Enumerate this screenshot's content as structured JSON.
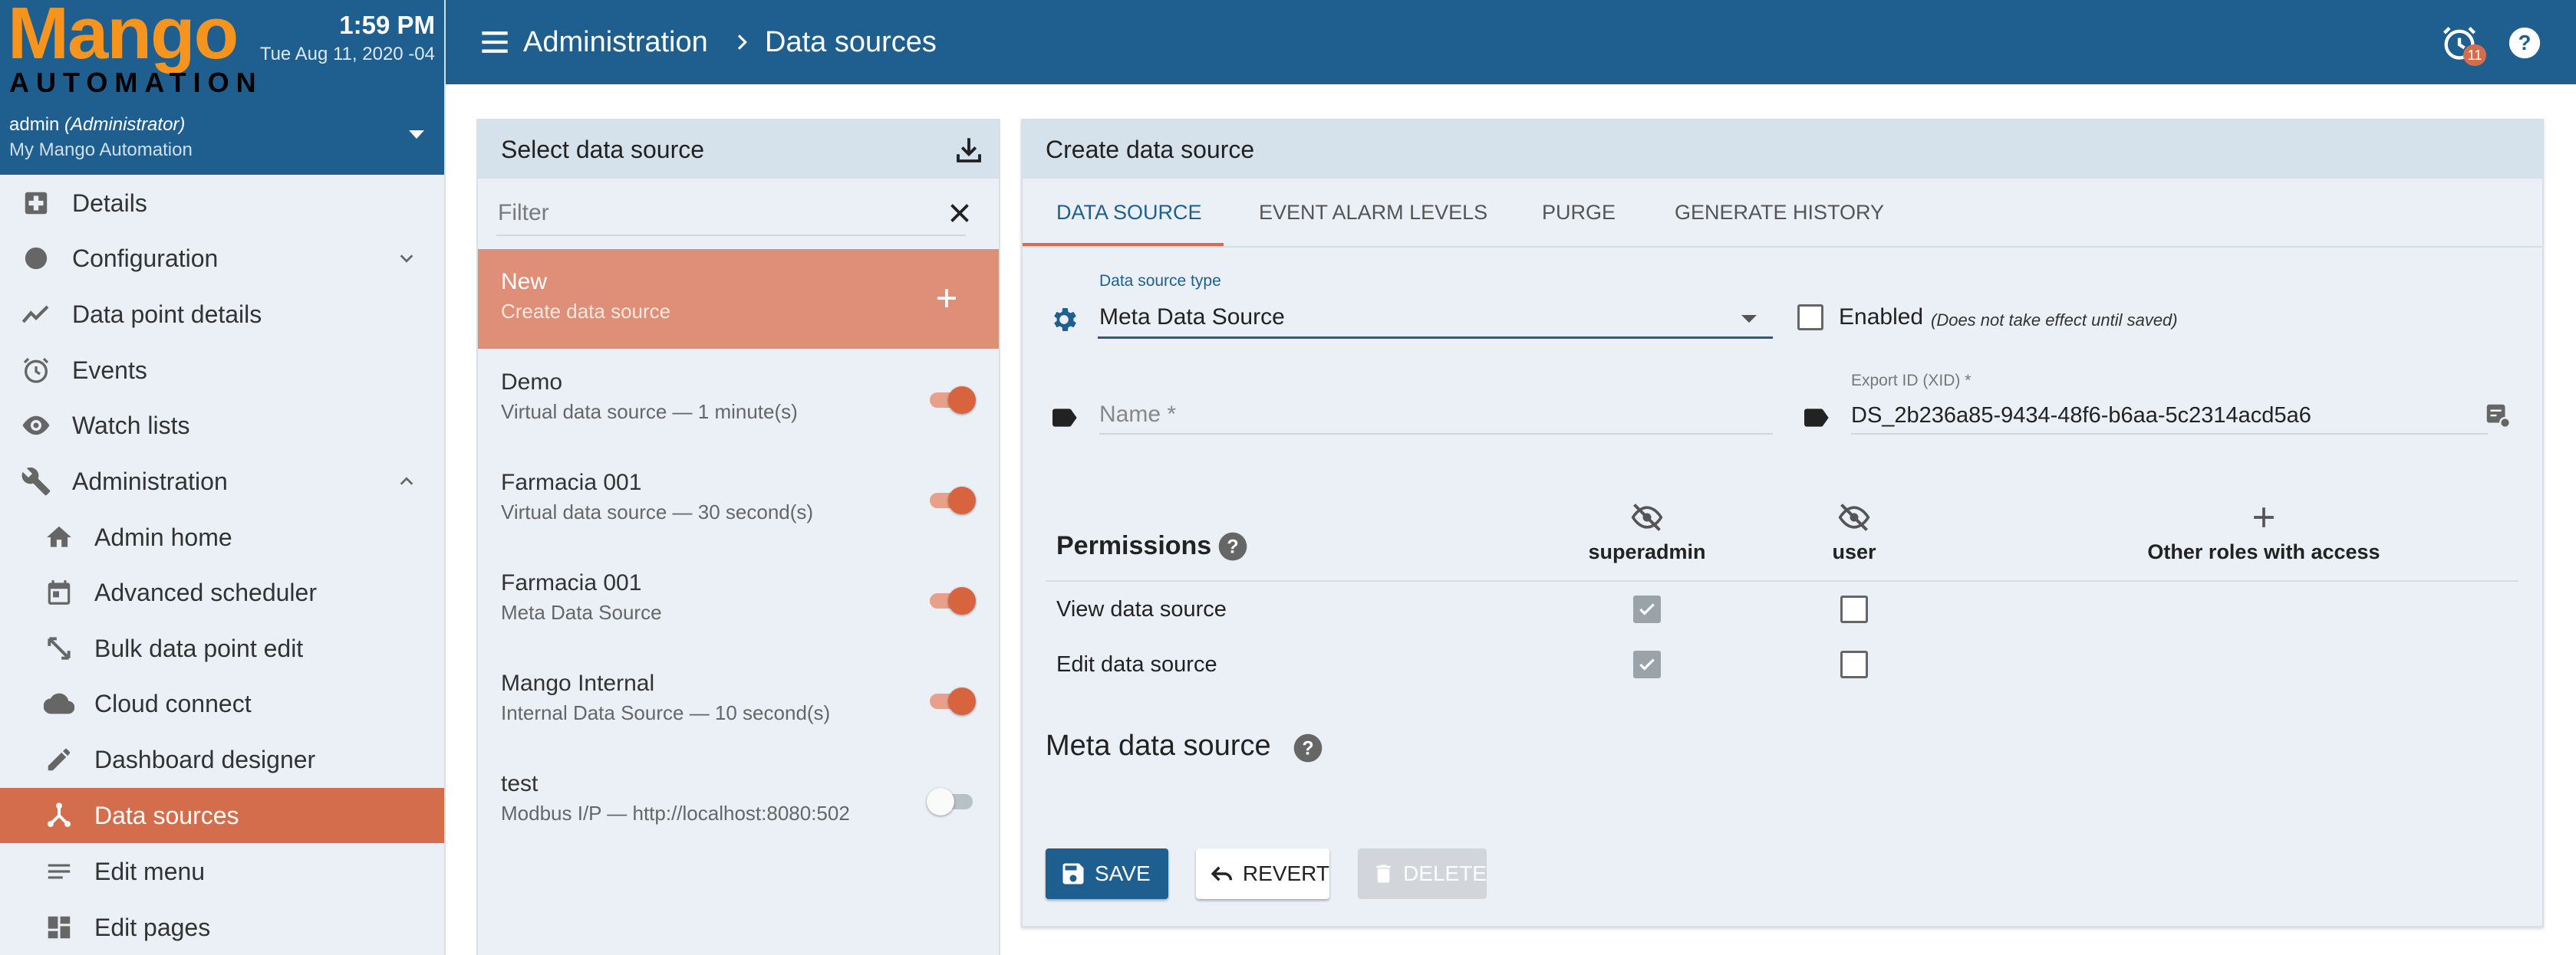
{
  "brand": {
    "logo_top": "Mango",
    "logo_bottom": "AUTOMATION",
    "time": "1:59 PM",
    "date": "Tue Aug 11, 2020 -04",
    "user_name": "admin",
    "user_role": "(Administrator)",
    "site_name": "My Mango Automation"
  },
  "sidebar": {
    "items": [
      {
        "label": "Details",
        "icon": "hospital-add-icon"
      },
      {
        "label": "Configuration",
        "icon": "circle-icon"
      },
      {
        "label": "Data point details",
        "icon": "trending-line-icon"
      },
      {
        "label": "Events",
        "icon": "alarm-clock-icon"
      },
      {
        "label": "Watch lists",
        "icon": "eye-icon"
      },
      {
        "label": "Administration",
        "icon": "wrench-icon"
      },
      {
        "label": "Admin home",
        "icon": "home-icon"
      },
      {
        "label": "Advanced scheduler",
        "icon": "calendar-icon"
      },
      {
        "label": "Bulk data point edit",
        "icon": "expand-arrows-icon"
      },
      {
        "label": "Cloud connect",
        "icon": "cloud-icon"
      },
      {
        "label": "Dashboard designer",
        "icon": "pencil-icon"
      },
      {
        "label": "Data sources",
        "icon": "share-nodes-icon"
      },
      {
        "label": "Edit menu",
        "icon": "list-icon"
      },
      {
        "label": "Edit pages",
        "icon": "dashboard-icon"
      }
    ],
    "active": "Data sources"
  },
  "topbar": {
    "breadcrumb_parent": "Administration",
    "breadcrumb_current": "Data sources",
    "alarm_count": "11"
  },
  "select_panel": {
    "title": "Select data source",
    "filter_placeholder": "Filter",
    "new_item": {
      "name": "New",
      "desc": "Create data source"
    },
    "items": [
      {
        "name": "Demo",
        "desc": "Virtual data source — 1 minute(s)",
        "enabled": true
      },
      {
        "name": "Farmacia 001",
        "desc": "Virtual data source — 30 second(s)",
        "enabled": true
      },
      {
        "name": "Farmacia 001",
        "desc": "Meta Data Source",
        "enabled": true
      },
      {
        "name": "Mango Internal",
        "desc": "Internal Data Source — 10 second(s)",
        "enabled": true
      },
      {
        "name": "test",
        "desc": "Modbus I/P — http://localhost:8080:502",
        "enabled": false
      }
    ]
  },
  "create_panel": {
    "title": "Create data source",
    "tabs": [
      "DATA SOURCE",
      "EVENT ALARM LEVELS",
      "PURGE",
      "GENERATE HISTORY"
    ],
    "active_tab": "DATA SOURCE",
    "type_label": "Data source type",
    "type_value": "Meta Data Source",
    "enabled_label": "Enabled",
    "enabled_note": "(Does not take effect until saved)",
    "enabled": false,
    "name_placeholder": "Name *",
    "name_value": "",
    "xid_label": "Export ID (XID) *",
    "xid_value": "DS_2b236a85-9434-48f6-b6aa-5c2314acd5a6",
    "permissions": {
      "title": "Permissions",
      "roles": [
        "superadmin",
        "user"
      ],
      "other_roles_label": "Other roles with access",
      "rows": [
        {
          "label": "View data source",
          "superadmin": true,
          "user": false
        },
        {
          "label": "Edit data source",
          "superadmin": true,
          "user": false
        }
      ]
    },
    "meta_title": "Meta data source",
    "buttons": {
      "save": "SAVE",
      "revert": "REVERT",
      "delete": "DELETE"
    }
  },
  "colors": {
    "primary": "#1f5f8f",
    "accent": "#d46d4c",
    "logo_orange": "#f7941d",
    "panel_bg": "#eaf0f5"
  }
}
